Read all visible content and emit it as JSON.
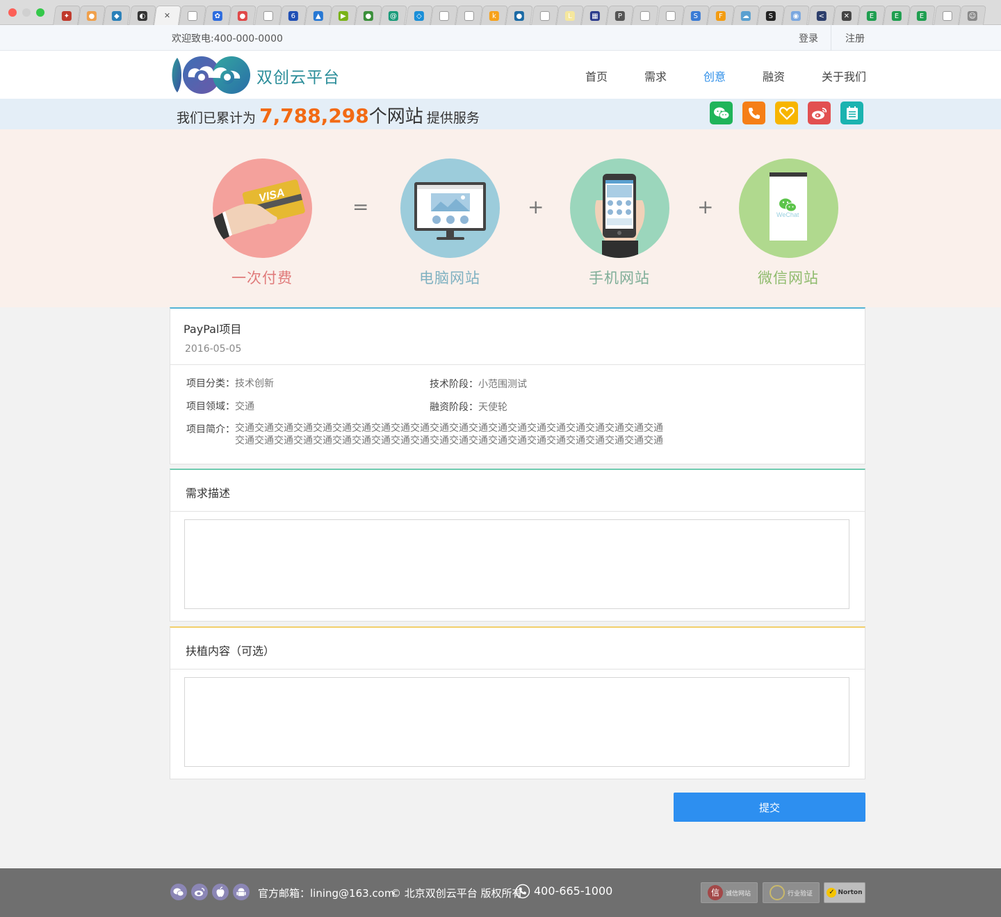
{
  "browser": {
    "tab_favicons": [
      {
        "color": "#c0392b",
        "glyph": "✦"
      },
      {
        "color": "#f0a04b",
        "glyph": "●"
      },
      {
        "color": "#2980b9",
        "glyph": "◆"
      },
      {
        "color": "#333333",
        "glyph": "◐"
      },
      {
        "color": "#f2f2f2",
        "glyph": "✕",
        "active": true
      },
      {
        "color": "#ffffff",
        "glyph": ""
      },
      {
        "color": "#2d6cdf",
        "glyph": "✿"
      },
      {
        "color": "#e04848",
        "glyph": "●"
      },
      {
        "color": "#ffffff",
        "glyph": ""
      },
      {
        "color": "#1f4fb5",
        "glyph": "6"
      },
      {
        "color": "#2778d4",
        "glyph": "▲"
      },
      {
        "color": "#7ab317",
        "glyph": "▶"
      },
      {
        "color": "#3a8f3a",
        "glyph": "●"
      },
      {
        "color": "#1a9b7a",
        "glyph": "@"
      },
      {
        "color": "#1a8fd8",
        "glyph": "◇"
      },
      {
        "color": "#ffffff",
        "glyph": ""
      },
      {
        "color": "#ffffff",
        "glyph": ""
      },
      {
        "color": "#f7a21b",
        "glyph": "k"
      },
      {
        "color": "#1b6aa5",
        "glyph": "●"
      },
      {
        "color": "#ffffff",
        "glyph": ""
      },
      {
        "color": "#f5e79e",
        "glyph": "L"
      },
      {
        "color": "#2b3a8c",
        "glyph": "▦"
      },
      {
        "color": "#555555",
        "glyph": "P"
      },
      {
        "color": "#ffffff",
        "glyph": ""
      },
      {
        "color": "#ffffff",
        "glyph": ""
      },
      {
        "color": "#3a7bd5",
        "glyph": "S"
      },
      {
        "color": "#f39c12",
        "glyph": "F"
      },
      {
        "color": "#5aa0d0",
        "glyph": "☁"
      },
      {
        "color": "#222222",
        "glyph": "S"
      },
      {
        "color": "#7aa7e0",
        "glyph": "◉"
      },
      {
        "color": "#2c3e6b",
        "glyph": "<"
      },
      {
        "color": "#444444",
        "glyph": "✕"
      },
      {
        "color": "#1e9e4f",
        "glyph": "E"
      },
      {
        "color": "#1e9e4f",
        "glyph": "E"
      },
      {
        "color": "#1e9e4f",
        "glyph": "E"
      },
      {
        "color": "#ffffff",
        "glyph": ""
      },
      {
        "color": "#888888",
        "glyph": "☺"
      }
    ]
  },
  "topbar": {
    "welcome": "欢迎致电:400-000-0000",
    "login": "登录",
    "register": "注册"
  },
  "header": {
    "site_name": "双创云平台",
    "nav": [
      "首页",
      "需求",
      "创意",
      "融资",
      "关于我们"
    ],
    "active_nav": "创意"
  },
  "stats": {
    "prefix": "我们已累计为",
    "count": "7,788,298",
    "unit": "个网站",
    "suffix": "提供服务"
  },
  "social": [
    {
      "name": "wechat",
      "color": "#1fb45a"
    },
    {
      "name": "phone",
      "color": "#f57f17"
    },
    {
      "name": "favorite",
      "color": "#f7b500"
    },
    {
      "name": "weibo",
      "color": "#e25050"
    },
    {
      "name": "notes",
      "color": "#1bb3b0"
    }
  ],
  "hero": {
    "items": [
      {
        "label": "一次付费",
        "color": "#e07a7a",
        "circle": "#f4a19c"
      },
      {
        "label": "电脑网站",
        "color": "#7fb1c1",
        "circle": "#9cccdb"
      },
      {
        "label": "手机网站",
        "color": "#7fae98",
        "circle": "#9bd6bc"
      },
      {
        "label": "微信网站",
        "color": "#8fbb6d",
        "circle": "#b0d98e"
      }
    ],
    "ops": [
      "=",
      "+",
      "+"
    ],
    "visa_text": "VISA",
    "wechat_text": "WeChat"
  },
  "project": {
    "title": "PayPal项目",
    "date": "2016-05-05",
    "category_label": "项目分类：",
    "category": "技术创新",
    "stage_label": "技术阶段：",
    "stage": "小范围测试",
    "field_label": "项目领域：",
    "field": "交通",
    "funding_label": "融资阶段：",
    "funding": "天使轮",
    "intro_label": "项目简介：",
    "intro": "交通交通交通交通交通交通交通交通交通交通交通交通交通交通交通交通交通交通交通交通交通交通交通交通交通交通交通交通交通交通交通交通交通交通交通交通交通交通交通交通交通交通交通交通"
  },
  "demand": {
    "title": "需求描述",
    "value": ""
  },
  "support": {
    "title": "扶植内容（可选）",
    "value": ""
  },
  "submit_label": "提交",
  "footer": {
    "email": "官方邮箱：lining@163.com",
    "copyright": "© 北京双创云平台 版权所有",
    "phone": "400-665-1000",
    "badges": [
      "诚信网站",
      "行业验证",
      "Norton"
    ]
  }
}
